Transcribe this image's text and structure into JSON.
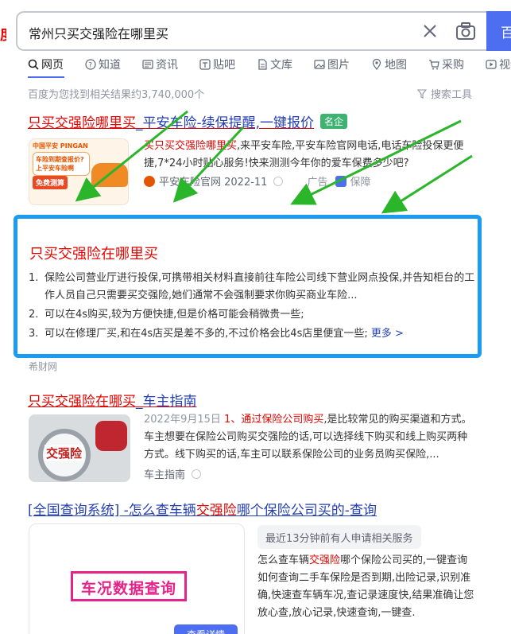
{
  "logo": {
    "fragment": "度"
  },
  "search": {
    "query": "常州只买交强险在哪里买",
    "button_label": "百"
  },
  "tabs": [
    {
      "label": "网页",
      "icon": "search-icon",
      "active": true
    },
    {
      "label": "知道",
      "icon": "question-icon"
    },
    {
      "label": "资讯",
      "icon": "news-icon"
    },
    {
      "label": "贴吧",
      "icon": "tieba-icon"
    },
    {
      "label": "文库",
      "icon": "document-icon"
    },
    {
      "label": "图片",
      "icon": "image-icon"
    },
    {
      "label": "地图",
      "icon": "map-pin-icon"
    },
    {
      "label": "采购",
      "icon": "cart-icon"
    },
    {
      "label": "视频",
      "icon": "video-icon"
    }
  ],
  "result_count": "百度为您找到相关结果约3,740,000个",
  "search_tools_label": "搜索工具",
  "result1": {
    "title_red": "只买交强险哪里买",
    "title_blue": "_平安车险-续保提醒,一键报价",
    "badge": "名企",
    "thumb": {
      "brand": "中国平安 PINGAN",
      "bubble": "车险到期查报价? 上平安车险啊",
      "cta": "免费测算"
    },
    "desc_highlight": "买只买交强险哪里买",
    "desc_rest": ",来平安车险,平安车险官网电话,电话车险投保更便捷,7*24小时贴心服务!快来测测今年你的爱车保费多少吧?",
    "source": "平安车险官网 2022-11",
    "ad_label": "广告",
    "v_label": "保障"
  },
  "featured": {
    "title": "只买交强险在哪里买",
    "items": [
      {
        "num": "1.",
        "text": "保险公司营业厅进行投保,可携带相关材料直接前往车险公司线下营业网点投保,并告知柜台的工作人员自己只需要买交强险,她们通常不会强制要求你购买商业车险..."
      },
      {
        "num": "2.",
        "text": "可以在4s购买,较为方便快捷,但是价格可能会稍微贵一些;"
      },
      {
        "num": "3.",
        "text": "可以在修理厂买,和在4s店买是差不多的,不过价格会比4s店里便宜一些;"
      }
    ],
    "more": "更多 >",
    "source": "希财网"
  },
  "result3": {
    "title_red": "只买交强险在哪买",
    "title_blue": "_车主指南",
    "thumb_text": "交强险",
    "date": "2022年9月15日",
    "desc_highlight": "1、通过保险公司购买",
    "desc_rest": ",是比较常见的购买渠道和方式。车主想要在保险公司购买交强险的话,可以选择线下购买和线上购买两种方式。线下购买的话,车主可以联系保险公司的业务员购买保险,...",
    "source": "车主指南"
  },
  "result4": {
    "title_a": "[全国查询系统] -怎么查车辆",
    "title_red": "交强险",
    "title_b": "哪个保险公司买的-查询",
    "card_label": "车况数据查询",
    "card_button": "查看详情",
    "recent": "最近13分钟前有人申请相关服务",
    "desc_a": "怎么查车辆",
    "desc_highlight": "交强险",
    "desc_b": "哪个保险公司买的,一键查询如何查询二手车保险是否到期,出险记录,识别准确,快速查车辆车况,查记录速度快,结果准确让您放心查,放心记录,快速查询,一键查."
  }
}
